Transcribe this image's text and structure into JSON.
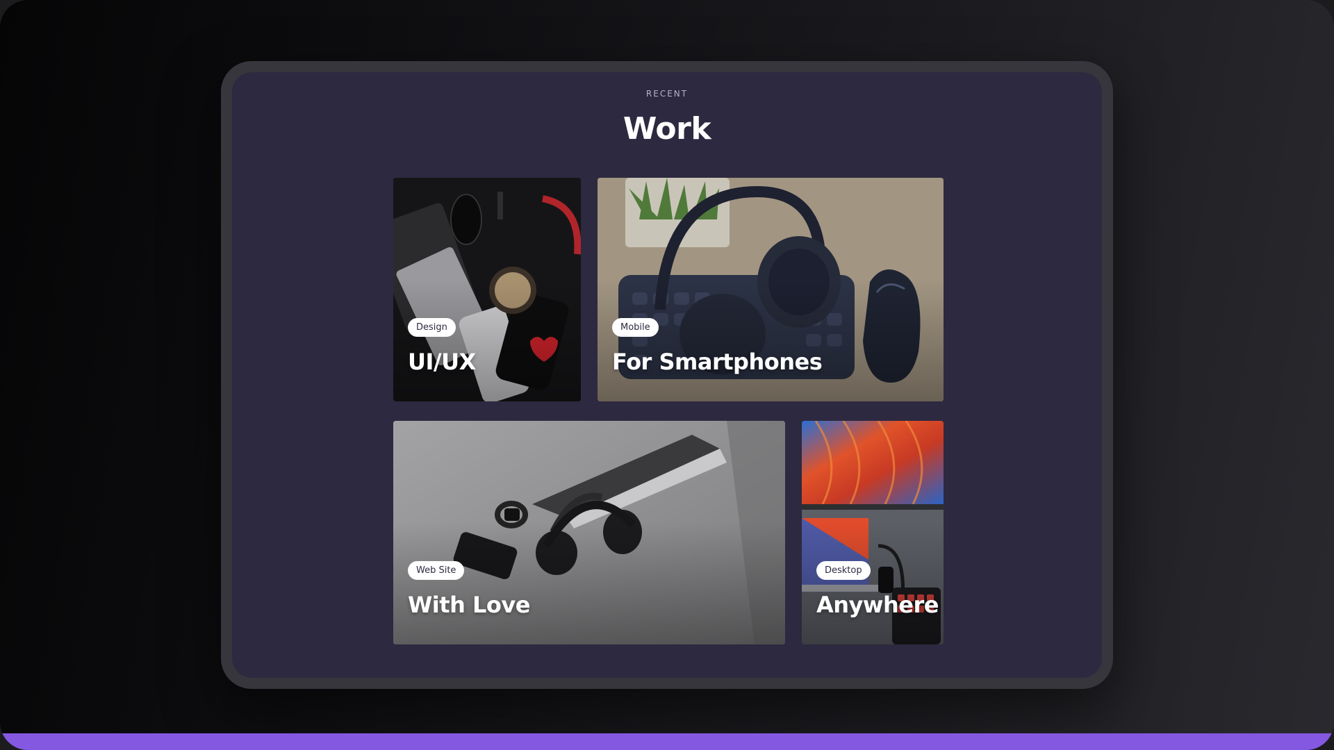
{
  "section": {
    "eyebrow": "RECENT",
    "title": "Work"
  },
  "cards": [
    {
      "badge": "Design",
      "title": "UI/UX",
      "image": "dark-flatlay-phone-headphones"
    },
    {
      "badge": "Mobile",
      "title": "For Smartphones",
      "image": "keyboard-headphones-mouse-desk"
    },
    {
      "badge": "Web Site",
      "title": "With Love",
      "image": "laptop-headphones-phone-desk"
    },
    {
      "badge": "Desktop",
      "title": "Anywhere",
      "image": "colorful-monitor-tablet-desk"
    }
  ],
  "colors": {
    "screen_bg": "#2d2940",
    "accent_bar": "#8458e0",
    "badge_bg": "#ffffff",
    "badge_text": "#2d2940"
  }
}
